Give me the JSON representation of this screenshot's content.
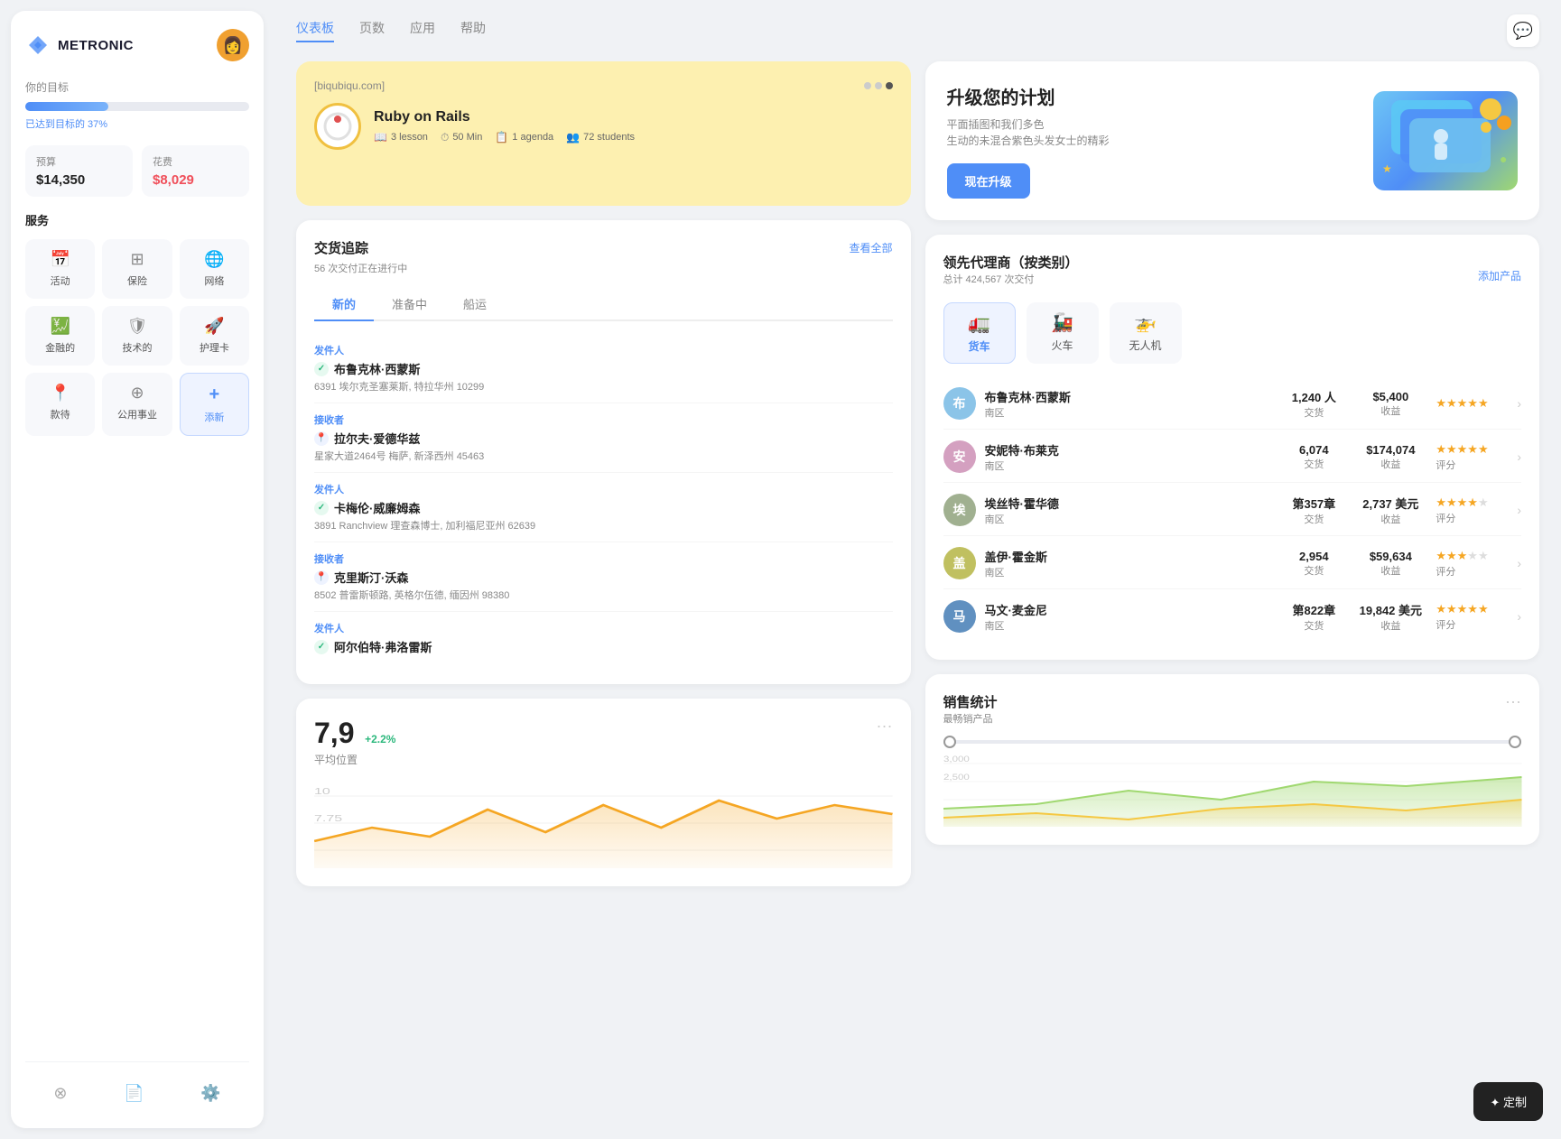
{
  "app": {
    "name": "METRONIC"
  },
  "nav": {
    "items": [
      {
        "label": "仪表板",
        "active": true
      },
      {
        "label": "页数",
        "active": false
      },
      {
        "label": "应用",
        "active": false
      },
      {
        "label": "帮助",
        "active": false
      }
    ]
  },
  "sidebar": {
    "goal_label": "你的目标",
    "goal_percent": "已达到目标的 37%",
    "budget_label": "预算",
    "budget_value": "$14,350",
    "expense_label": "花费",
    "expense_value": "$8,029",
    "services_label": "服务",
    "services": [
      {
        "label": "活动",
        "icon": "📅"
      },
      {
        "label": "保险",
        "icon": "⊞"
      },
      {
        "label": "网络",
        "icon": "🌐"
      },
      {
        "label": "金融的",
        "icon": "💹"
      },
      {
        "label": "技术的",
        "icon": "🛡"
      },
      {
        "label": "护理卡",
        "icon": "🚀"
      },
      {
        "label": "款待",
        "icon": "📍"
      },
      {
        "label": "公用事业",
        "icon": "⊕"
      },
      {
        "label": "添新",
        "icon": "+",
        "active": true
      }
    ],
    "footer_icons": [
      "layers",
      "document",
      "settings"
    ]
  },
  "course_card": {
    "url": "[biqubiqu.com]",
    "title": "Ruby on Rails",
    "meta": [
      {
        "icon": "📖",
        "text": "3 lesson"
      },
      {
        "icon": "⏱",
        "text": "50 Min"
      },
      {
        "icon": "📋",
        "text": "1 agenda"
      },
      {
        "icon": "👥",
        "text": "72 students"
      }
    ]
  },
  "upgrade_card": {
    "title": "升级您的计划",
    "desc_line1": "平面插图和我们多色",
    "desc_line2": "生动的未混合紫色头发女士的精彩",
    "button": "现在升级"
  },
  "tracking": {
    "title": "交货追踪",
    "subtitle": "56 次交付正在进行中",
    "link": "查看全部",
    "tabs": [
      "新的",
      "准备中",
      "船运"
    ],
    "active_tab": 0,
    "items": [
      {
        "role": "发件人",
        "name": "布鲁克林·西蒙斯",
        "address": "6391 埃尔克圣塞莱斯, 特拉华州 10299",
        "status": "green"
      },
      {
        "role": "接收者",
        "name": "拉尔夫·爱德华兹",
        "address": "星家大道2464号 梅萨, 新泽西州 45463",
        "status": "blue"
      },
      {
        "role": "发件人",
        "name": "卡梅伦·威廉姆森",
        "address": "3891 Ranchview 理查森博士, 加利福尼亚州 62639",
        "status": "green"
      },
      {
        "role": "接收者",
        "name": "克里斯汀·沃森",
        "address": "8502 普雷斯顿路, 英格尔伍德, 缅因州 98380",
        "status": "blue"
      },
      {
        "role": "发件人",
        "name": "阿尔伯特·弗洛雷斯",
        "address": "",
        "status": "green"
      }
    ]
  },
  "agents": {
    "title": "领先代理商（按类别）",
    "subtitle": "总计 424,567 次交付",
    "add_btn": "添加产品",
    "tabs": [
      {
        "label": "货车",
        "icon": "🚛",
        "active": true
      },
      {
        "label": "火车",
        "icon": "🚂",
        "active": false
      },
      {
        "label": "无人机",
        "icon": "🚁",
        "active": false
      }
    ],
    "agents": [
      {
        "name": "布鲁克林·西蒙斯",
        "region": "南区",
        "transactions": "1,240 人",
        "tx_label": "交货",
        "revenue": "$5,400",
        "rev_label": "收益",
        "rating": 5,
        "rating_label": "",
        "color": "#8bc4e8"
      },
      {
        "name": "安妮特·布莱克",
        "region": "南区",
        "transactions": "6,074",
        "tx_label": "交货",
        "revenue": "$174,074",
        "rev_label": "收益",
        "rating": 5,
        "rating_label": "评分",
        "color": "#d4a0c0"
      },
      {
        "name": "埃丝特·霍华德",
        "region": "南区",
        "transactions": "第357章",
        "tx_label": "交货",
        "revenue": "2,737 美元",
        "rev_label": "收益",
        "rating": 4,
        "rating_label": "评分",
        "color": "#a0b090"
      },
      {
        "name": "盖伊·霍金斯",
        "region": "南区",
        "transactions": "2,954",
        "tx_label": "交货",
        "revenue": "$59,634",
        "rev_label": "收益",
        "rating": 3,
        "rating_label": "评分",
        "color": "#c0c060"
      },
      {
        "name": "马文·麦金尼",
        "region": "南区",
        "transactions": "第822章",
        "tx_label": "交货",
        "revenue": "19,842 美元",
        "rev_label": "收益",
        "rating": 5,
        "rating_label": "评分",
        "color": "#6090c0"
      }
    ]
  },
  "stats": {
    "value": "7,9",
    "trend": "+2.2%",
    "label": "平均位置",
    "chart_values": [
      7,
      8.5,
      7.75,
      9,
      8,
      9.5,
      8,
      10,
      8.5,
      9
    ]
  },
  "sales": {
    "title": "销售统计",
    "subtitle": "最畅销产品"
  },
  "customize": {
    "button": "✦ 定制"
  }
}
